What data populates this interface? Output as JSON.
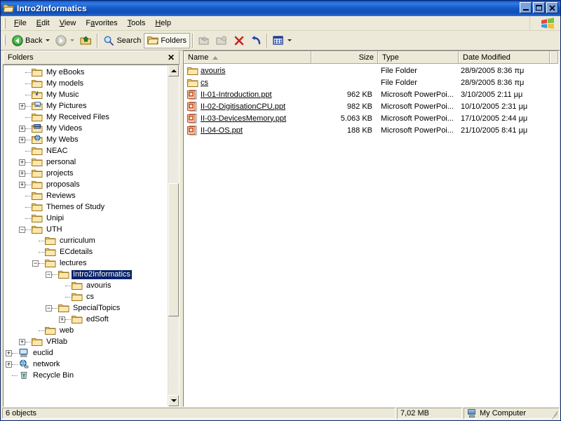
{
  "window": {
    "title": "Intro2Informatics",
    "title_icon": "folder-open-icon",
    "buttons": {
      "minimize": "_",
      "maximize": "❐",
      "close": "✕"
    }
  },
  "menu": {
    "items": [
      {
        "label": "File",
        "accel": "F"
      },
      {
        "label": "Edit",
        "accel": "E"
      },
      {
        "label": "View",
        "accel": "V"
      },
      {
        "label": "Favorites",
        "accel": "a"
      },
      {
        "label": "Tools",
        "accel": "T"
      },
      {
        "label": "Help",
        "accel": "H"
      }
    ],
    "brand_icon": "windows-flag-icon"
  },
  "toolbar": {
    "back_label": "Back",
    "forward_label": "",
    "up_label": "",
    "search_label": "Search",
    "folders_label": "Folders",
    "moveto_label": "",
    "copyto_label": "",
    "delete_label": "",
    "undo_label": "",
    "views_label": ""
  },
  "folders_pane": {
    "header": "Folders",
    "close_label": "✕",
    "tree": [
      {
        "label": "My eBooks",
        "indent": 4,
        "expander": "none",
        "icon": "folder-icon"
      },
      {
        "label": "My models",
        "indent": 4,
        "expander": "none",
        "icon": "folder-icon"
      },
      {
        "label": "My Music",
        "indent": 4,
        "expander": "none",
        "icon": "music-folder-icon"
      },
      {
        "label": "My Pictures",
        "indent": 4,
        "expander": "plus",
        "icon": "pictures-folder-icon"
      },
      {
        "label": "My Received Files",
        "indent": 4,
        "expander": "none",
        "icon": "folder-icon"
      },
      {
        "label": "My Videos",
        "indent": 4,
        "expander": "plus",
        "icon": "videos-folder-icon"
      },
      {
        "label": "My Webs",
        "indent": 4,
        "expander": "plus",
        "icon": "web-folder-icon"
      },
      {
        "label": "NEAC",
        "indent": 4,
        "expander": "none",
        "icon": "folder-icon"
      },
      {
        "label": "personal",
        "indent": 4,
        "expander": "plus",
        "icon": "folder-icon"
      },
      {
        "label": "projects",
        "indent": 4,
        "expander": "plus",
        "icon": "folder-icon"
      },
      {
        "label": "proposals",
        "indent": 4,
        "expander": "plus",
        "icon": "folder-icon"
      },
      {
        "label": "Reviews",
        "indent": 4,
        "expander": "none",
        "icon": "folder-icon"
      },
      {
        "label": "Themes of Study",
        "indent": 4,
        "expander": "none",
        "icon": "folder-icon"
      },
      {
        "label": "Unipi",
        "indent": 4,
        "expander": "none",
        "icon": "folder-icon"
      },
      {
        "label": "UTH",
        "indent": 4,
        "expander": "minus",
        "icon": "folder-icon"
      },
      {
        "label": "curriculum",
        "indent": 5,
        "expander": "none",
        "icon": "folder-icon"
      },
      {
        "label": "ECdetails",
        "indent": 5,
        "expander": "none",
        "icon": "folder-icon"
      },
      {
        "label": "lectures",
        "indent": 5,
        "expander": "minus",
        "icon": "folder-icon"
      },
      {
        "label": "Intro2Informatics",
        "indent": 6,
        "expander": "minus",
        "icon": "folder-icon",
        "selected": true
      },
      {
        "label": "avouris",
        "indent": 7,
        "expander": "none",
        "icon": "folder-icon"
      },
      {
        "label": "cs",
        "indent": 7,
        "expander": "none",
        "icon": "folder-icon"
      },
      {
        "label": "SpecialTopics",
        "indent": 6,
        "expander": "minus",
        "icon": "folder-icon"
      },
      {
        "label": "edSoft",
        "indent": 7,
        "expander": "plus",
        "icon": "folder-icon"
      },
      {
        "label": "web",
        "indent": 5,
        "expander": "none",
        "icon": "folder-icon"
      },
      {
        "label": "VRlab",
        "indent": 4,
        "expander": "plus",
        "icon": "folder-icon"
      },
      {
        "label": "euclid",
        "indent": 3,
        "expander": "plus",
        "icon": "computer-icon"
      },
      {
        "label": "network",
        "indent": 3,
        "expander": "plus",
        "icon": "network-icon"
      },
      {
        "label": "Recycle Bin",
        "indent": 3,
        "expander": "none",
        "icon": "recycle-bin-icon"
      }
    ],
    "scrollbar": {
      "up_arrow": "▲",
      "down_arrow": "▼"
    }
  },
  "file_list": {
    "columns": [
      {
        "label": "Name",
        "sorted": "asc"
      },
      {
        "label": "Size",
        "sorted": ""
      },
      {
        "label": "Type",
        "sorted": ""
      },
      {
        "label": "Date Modified",
        "sorted": ""
      }
    ],
    "rows": [
      {
        "name": "avouris",
        "icon": "folder-icon",
        "size": "",
        "type": "File Folder",
        "date": "28/9/2005 8:36 πμ"
      },
      {
        "name": "cs",
        "icon": "folder-icon",
        "size": "",
        "type": "File Folder",
        "date": "28/9/2005 8:36 πμ"
      },
      {
        "name": "II-01-Introduction.ppt",
        "icon": "powerpoint-icon",
        "size": "962 KB",
        "type": "Microsoft PowerPoi...",
        "date": "3/10/2005 2:11 μμ"
      },
      {
        "name": "II-02-DigitisationCPU.ppt",
        "icon": "powerpoint-icon",
        "size": "982 KB",
        "type": "Microsoft PowerPoi...",
        "date": "10/10/2005 2:31 μμ"
      },
      {
        "name": "II-03-DevicesMemory.ppt",
        "icon": "powerpoint-icon",
        "size": "5.063 KB",
        "type": "Microsoft PowerPoi...",
        "date": "17/10/2005 2:44 μμ"
      },
      {
        "name": "II-04-OS.ppt",
        "icon": "powerpoint-icon",
        "size": "188 KB",
        "type": "Microsoft PowerPoi...",
        "date": "21/10/2005 8:41 μμ"
      }
    ]
  },
  "status_bar": {
    "objects": "6 objects",
    "size": "7,02 MB",
    "location": "My Computer",
    "location_icon": "my-computer-icon"
  },
  "colors": {
    "title_active": "#1557c4",
    "selection": "#0a246a",
    "face": "#ece9d8",
    "folder_yellow": "#fcd97a",
    "delete_red": "#cc2222",
    "undo_blue": "#2244aa"
  }
}
